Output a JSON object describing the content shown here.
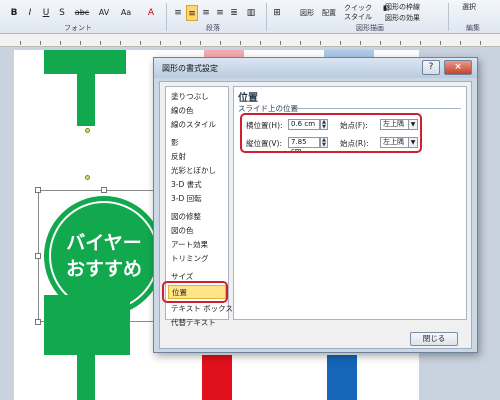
{
  "ribbon": {
    "bold": "B",
    "italic": "I",
    "underline": "U",
    "strike": "S",
    "abc": "abc",
    "av": "AV",
    "aa": "Aa",
    "shape_btn": "図形",
    "arrange_btn": "配置",
    "quick_style": "クイック\nスタイル",
    "outline": "図形の枠線",
    "effect": "図形の効果",
    "select": "選択",
    "groups": {
      "font": "フォント",
      "paragraph": "段落",
      "drawing": "図形描画",
      "editing": "編集"
    }
  },
  "colors": {
    "green": "#12a84d",
    "red": "#e0101c",
    "blue": "#1565b8",
    "highlight": "#d0202f",
    "active_nav": "#ffe58a"
  },
  "slide": {
    "circle_line1": "バイヤー",
    "circle_line2": "おすすめ"
  },
  "dialog": {
    "title": "図形の書式設定",
    "help": "?",
    "close_x": "×",
    "nav": [
      "塗りつぶし",
      "線の色",
      "線のスタイル",
      "影",
      "反射",
      "光彩とぼかし",
      "3-D 書式",
      "3-D 回転",
      "図の修整",
      "図の色",
      "アート効果",
      "トリミング",
      "サイズ",
      "位置",
      "テキスト ボックス",
      "代替テキスト"
    ],
    "panel_title": "位置",
    "panel_subtitle": "スライド上の位置",
    "h_label": "横位置(H):",
    "h_value": "0.6 cm",
    "h_from_label": "始点(F):",
    "h_from": "左上隅",
    "v_label": "縦位置(V):",
    "v_value": "7.85 cm",
    "v_from_label": "始点(R):",
    "v_from": "左上隅",
    "close_button": "閉じる"
  }
}
